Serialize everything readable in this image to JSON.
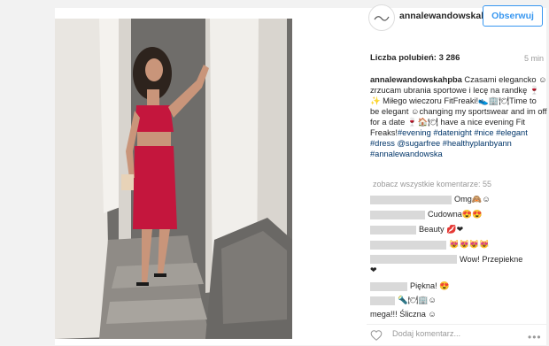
{
  "header": {
    "username": "annalewandowskahpba",
    "follow_label": "Obserwuj"
  },
  "post": {
    "likes": "Liczba polubień: 3 286",
    "time": "5 min"
  },
  "caption": {
    "author": "annalewandowskahpba",
    "text1": " Czasami elegancko ☺ zrzucam ubrania sportowe i lecę na randkę 🍷✨ Miłego wieczoru FitFreaki!👟🏢🍽Time to be elegant ☺changing my sportswear and im off for a date 🍷🏠🍽 have a nice evening Fit Freaks!",
    "tags": "#evening #datenight #nice #elegant #dress @sugarfree #healthyplanbyann #annalewandowska"
  },
  "comments": {
    "more_label": "zobacz wszystkie komentarze: 55",
    "items": [
      {
        "text": "Omg🙈☺"
      },
      {
        "text": "Cudowna😍😍"
      },
      {
        "text": "Beauty 💋❤"
      },
      {
        "text": "😻😻😻😻"
      },
      {
        "text": "Wow! Przepiekne"
      },
      {
        "text": "❤"
      },
      {
        "text": "Piękna! 😍"
      },
      {
        "text": "🔦🍽🏢☺"
      },
      {
        "text": "mega!!! Śliczna ☺"
      }
    ]
  },
  "footer": {
    "comment_placeholder": "Dodaj komentarz..."
  },
  "colors": {
    "accent": "#3897f0",
    "text": "#262626",
    "muted": "#999999",
    "link": "#003569"
  }
}
